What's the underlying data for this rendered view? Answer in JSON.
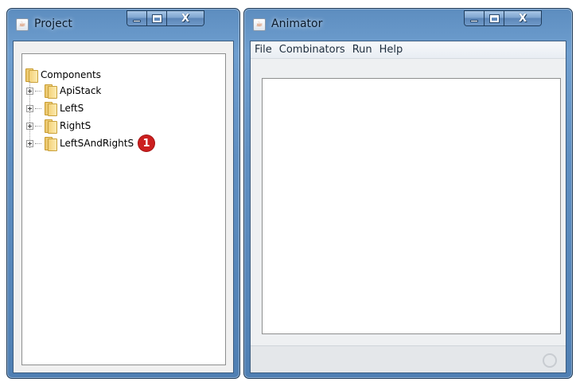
{
  "project_window": {
    "title": "Project",
    "icon": "java-cup-icon",
    "tree": {
      "root": "Components",
      "children": [
        "ApiStack",
        "LeftS",
        "RightS",
        "LeftSAndRightS"
      ],
      "badge": "1"
    }
  },
  "animator_window": {
    "title": "Animator",
    "icon": "java-cup-icon",
    "menu": [
      "File",
      "Combinators",
      "Run",
      "Help"
    ]
  },
  "caption_buttons": {
    "close_label": "X"
  },
  "colors": {
    "titlebar": "#5f8fc2",
    "badge": "#cc1f1f",
    "folder": "#f3d179"
  }
}
